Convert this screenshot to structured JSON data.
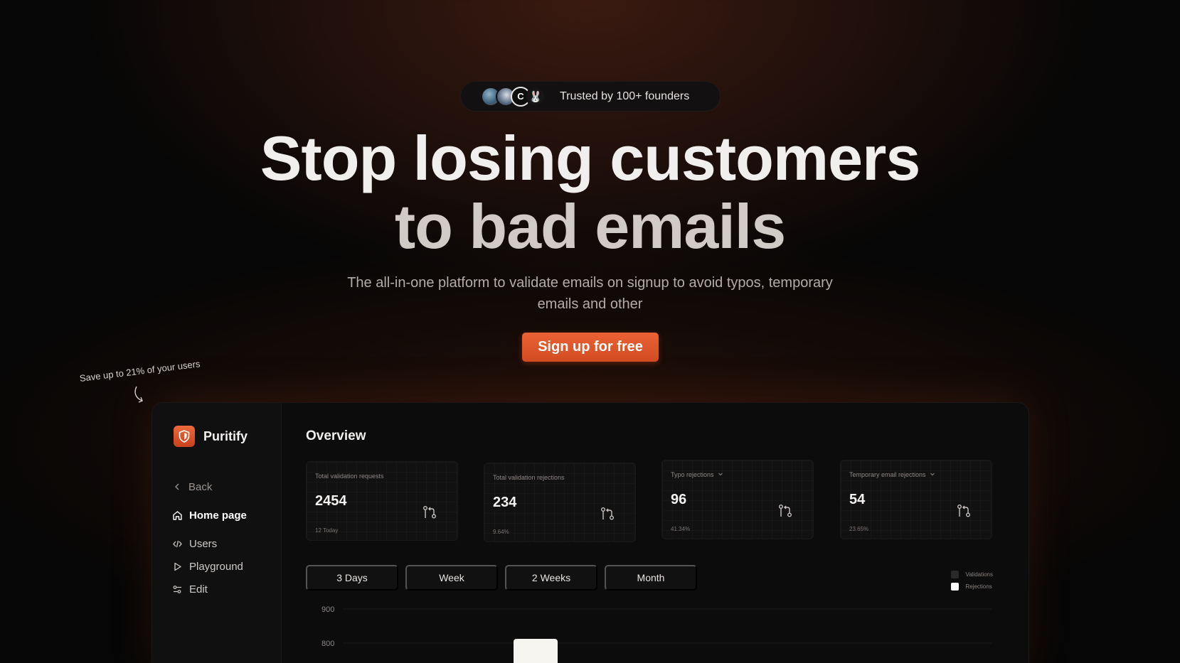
{
  "trusted": {
    "text": "Trusted by 100+ founders",
    "avatar3_letter": "C",
    "avatar4_glyph": "🐰"
  },
  "hero": {
    "headline_line1": "Stop losing customers",
    "headline_line2": "to bad emails",
    "subtitle": "The all-in-one platform to validate emails on signup to avoid typos, temporary emails and other",
    "cta_label": "Sign up for free"
  },
  "annotation": {
    "text": "Save up to 21% of your users"
  },
  "app": {
    "brand": {
      "name": "Puritify",
      "icon": "shield-icon"
    },
    "nav": {
      "back": "Back",
      "items": [
        {
          "label": "Home page",
          "icon": "home-icon",
          "active": true
        },
        {
          "label": "Users",
          "icon": "code-icon"
        },
        {
          "label": "Playground",
          "icon": "play-icon"
        },
        {
          "label": "Edit",
          "icon": "sliders-icon"
        }
      ]
    },
    "overview": {
      "title": "Overview",
      "cards": [
        {
          "label": "Total validation requests",
          "value": "2454",
          "sub": "12 Today",
          "icon": "git-pull-request-icon"
        },
        {
          "label": "Total validation rejections",
          "value": "234",
          "sub": "9.64%",
          "icon": "git-pull-request-icon"
        },
        {
          "label": "Typo rejections",
          "value": "96",
          "sub": "41.34%",
          "icon": "git-pull-request-icon",
          "dropdown": true
        },
        {
          "label": "Temporary email rejections",
          "value": "54",
          "sub": "23.65%",
          "icon": "git-pull-request-icon",
          "dropdown": true
        }
      ]
    },
    "ranges": [
      "3 Days",
      "Week",
      "2 Weeks",
      "Month"
    ],
    "legend": [
      {
        "label": "Validations",
        "color": "#2a2828"
      },
      {
        "label": "Rejections",
        "color": "#ffffff"
      }
    ]
  },
  "chart_data": {
    "type": "bar",
    "title": "",
    "xlabel": "",
    "ylabel": "",
    "y_ticks": [
      900,
      800
    ],
    "series": [
      {
        "name": "Validations",
        "values": []
      },
      {
        "name": "Rejections",
        "values": []
      }
    ],
    "legend": "top-right",
    "grid": true
  },
  "colors": {
    "accent": "#e35a2d",
    "background": "#060606",
    "panel": "#121111"
  }
}
